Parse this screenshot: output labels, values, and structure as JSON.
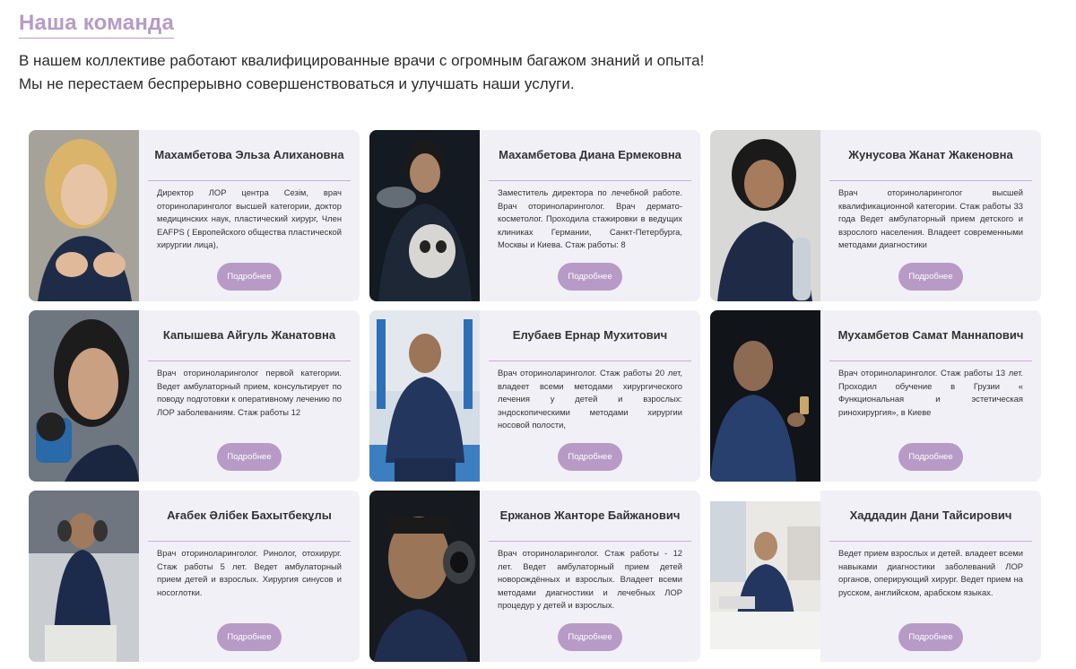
{
  "header": {
    "title": "Наша команда",
    "intro_line1": "В нашем коллективе работают квалифицированные врачи с огромным багажом знаний и опыта!",
    "intro_line2": "Мы не перестаем беспрерывно совершенствоваться и улучшать наши услуги."
  },
  "more_label": "Подробнее",
  "doctors": [
    {
      "name": "Махамбетова Эльза Алихановна",
      "desc": "Директор ЛОР центра Сезім, врач оториноларинголог высшей категории, доктор медицинских наук, пластический хирург, Член EAFPS ( Европейского общества пластической хирургии лица),"
    },
    {
      "name": "Махамбетова Диана Ермековна",
      "desc": "Заместитель директора по лечебной работе. Врач оториноларинголог. Врач дермато-косметолог. Проходила стажировки в ведущих клиниках Германии, Санкт-Петербурга, Москвы и Киева. Стаж работы: 8"
    },
    {
      "name": "Жунусова Жанат Жакеновна",
      "desc": "Врач оториноларинголог высшей квалификационной категории. Стаж работы 33 года Ведет амбулаторный прием детского и взрослого населения. Владеет современными методами диагностики"
    },
    {
      "name": "Капышева Айгуль Жанатовна",
      "desc": "Врач оториноларинголог первой категории. Ведет амбулаторный прием, консультирует по поводу подготовки к оперативному лечению по ЛОР заболеваниям. Стаж работы 12"
    },
    {
      "name": "Елубаев Ернар Мухитович",
      "desc": "Врач оториноларинголог. Стаж работы 20 лет, владеет всеми методами хирургического лечения у детей и взрослых: эндоскопическими методами хирургии носовой полости,"
    },
    {
      "name": "Мухамбетов Самат Маннапович",
      "desc": "Врач оториноларинголог. Стаж работы 13 лет. Проходил обучение в Грузии « Функциональная и эстетическая ринохирургия», в Киеве"
    },
    {
      "name": "Ағабек Әлібек Бахытбекұлы",
      "desc": "Врач оториноларинголог. Ринолог, отохирург. Стаж работы 5 лет. Ведет амбулаторный прием детей и взрослых. Хирургия синусов и носоглотки."
    },
    {
      "name": "Ержанов Жанторе Байжанович",
      "desc": "Врач оториноларинголог. Стаж работы - 12 лет. Ведет амбулаторный прием детей новорождённых и взрослых. Владеет всеми методами диагностики и лечебных ЛОР процедур у детей и взрослых."
    },
    {
      "name": "Хаддадин Дани Тайсирович",
      "desc": "Ведет прием взрослых и детей. владеет всеми навыками диагностики заболеваний ЛОР органов, оперирующий хирург. Ведет прием на русском, английском, арабском языках."
    }
  ]
}
